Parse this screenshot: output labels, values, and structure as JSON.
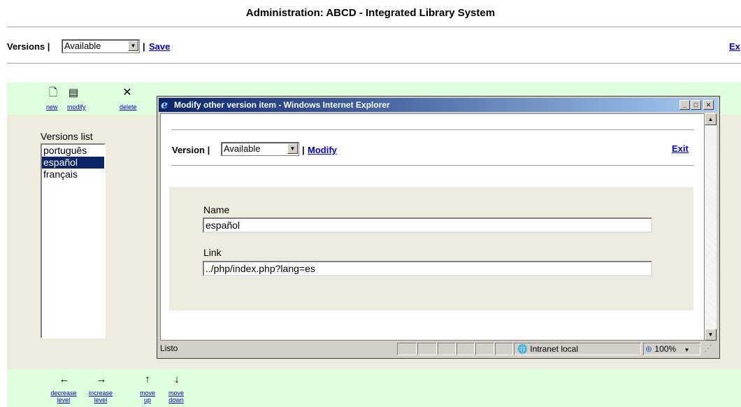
{
  "header": {
    "title": "Administration: ABCD - Integrated Library System"
  },
  "top_bar": {
    "versions_label": "Versions |",
    "selected_version": "Available",
    "separator": "|",
    "save_label": "Save",
    "exit_label": "Ex"
  },
  "toolbar": {
    "new_label": "new",
    "modify_label": "modify",
    "delete_label": "delete"
  },
  "versions_list": {
    "caption": "Versions list",
    "items": [
      "português",
      "español",
      "français"
    ],
    "selected_index": 1
  },
  "popup": {
    "window_title": "Modify other version item - Windows Internet Explorer",
    "version_label": "Version |",
    "selected_version": "Available",
    "separator": "|",
    "modify_label": "Modify",
    "exit_label": "Exit",
    "name_label": "Name",
    "name_value": "español",
    "link_label": "Link",
    "link_value": "../php/index.php?lang=es",
    "status_text": "Listo",
    "zone_text": "Intranet local",
    "zoom_text": "100%"
  },
  "bottom_toolbar": {
    "decrease_label_1": "decrease",
    "decrease_label_2": "level",
    "increase_label_1": "increase",
    "increase_label_2": "level",
    "move_up_label_1": "move",
    "move_up_label_2": "up",
    "move_down_label_1": "move",
    "move_down_label_2": "down"
  },
  "colors": {
    "toolbar_band": "#ddfddd",
    "content_bg": "#ecebdd",
    "selection": "#0a246a",
    "link": "#0000cc"
  }
}
